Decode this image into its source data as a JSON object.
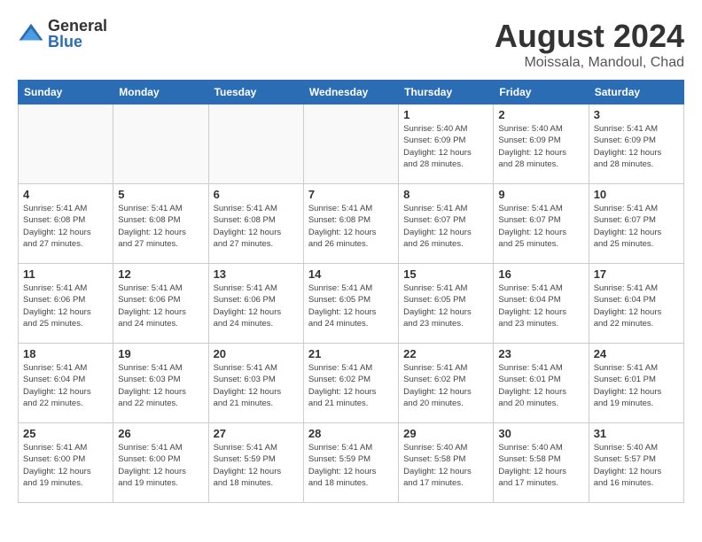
{
  "header": {
    "logo_general": "General",
    "logo_blue": "Blue",
    "month_year": "August 2024",
    "location": "Moissala, Mandoul, Chad"
  },
  "weekdays": [
    "Sunday",
    "Monday",
    "Tuesday",
    "Wednesday",
    "Thursday",
    "Friday",
    "Saturday"
  ],
  "weeks": [
    [
      {
        "day": "",
        "detail": ""
      },
      {
        "day": "",
        "detail": ""
      },
      {
        "day": "",
        "detail": ""
      },
      {
        "day": "",
        "detail": ""
      },
      {
        "day": "1",
        "detail": "Sunrise: 5:40 AM\nSunset: 6:09 PM\nDaylight: 12 hours\nand 28 minutes."
      },
      {
        "day": "2",
        "detail": "Sunrise: 5:40 AM\nSunset: 6:09 PM\nDaylight: 12 hours\nand 28 minutes."
      },
      {
        "day": "3",
        "detail": "Sunrise: 5:41 AM\nSunset: 6:09 PM\nDaylight: 12 hours\nand 28 minutes."
      }
    ],
    [
      {
        "day": "4",
        "detail": "Sunrise: 5:41 AM\nSunset: 6:08 PM\nDaylight: 12 hours\nand 27 minutes."
      },
      {
        "day": "5",
        "detail": "Sunrise: 5:41 AM\nSunset: 6:08 PM\nDaylight: 12 hours\nand 27 minutes."
      },
      {
        "day": "6",
        "detail": "Sunrise: 5:41 AM\nSunset: 6:08 PM\nDaylight: 12 hours\nand 27 minutes."
      },
      {
        "day": "7",
        "detail": "Sunrise: 5:41 AM\nSunset: 6:08 PM\nDaylight: 12 hours\nand 26 minutes."
      },
      {
        "day": "8",
        "detail": "Sunrise: 5:41 AM\nSunset: 6:07 PM\nDaylight: 12 hours\nand 26 minutes."
      },
      {
        "day": "9",
        "detail": "Sunrise: 5:41 AM\nSunset: 6:07 PM\nDaylight: 12 hours\nand 25 minutes."
      },
      {
        "day": "10",
        "detail": "Sunrise: 5:41 AM\nSunset: 6:07 PM\nDaylight: 12 hours\nand 25 minutes."
      }
    ],
    [
      {
        "day": "11",
        "detail": "Sunrise: 5:41 AM\nSunset: 6:06 PM\nDaylight: 12 hours\nand 25 minutes."
      },
      {
        "day": "12",
        "detail": "Sunrise: 5:41 AM\nSunset: 6:06 PM\nDaylight: 12 hours\nand 24 minutes."
      },
      {
        "day": "13",
        "detail": "Sunrise: 5:41 AM\nSunset: 6:06 PM\nDaylight: 12 hours\nand 24 minutes."
      },
      {
        "day": "14",
        "detail": "Sunrise: 5:41 AM\nSunset: 6:05 PM\nDaylight: 12 hours\nand 24 minutes."
      },
      {
        "day": "15",
        "detail": "Sunrise: 5:41 AM\nSunset: 6:05 PM\nDaylight: 12 hours\nand 23 minutes."
      },
      {
        "day": "16",
        "detail": "Sunrise: 5:41 AM\nSunset: 6:04 PM\nDaylight: 12 hours\nand 23 minutes."
      },
      {
        "day": "17",
        "detail": "Sunrise: 5:41 AM\nSunset: 6:04 PM\nDaylight: 12 hours\nand 22 minutes."
      }
    ],
    [
      {
        "day": "18",
        "detail": "Sunrise: 5:41 AM\nSunset: 6:04 PM\nDaylight: 12 hours\nand 22 minutes."
      },
      {
        "day": "19",
        "detail": "Sunrise: 5:41 AM\nSunset: 6:03 PM\nDaylight: 12 hours\nand 22 minutes."
      },
      {
        "day": "20",
        "detail": "Sunrise: 5:41 AM\nSunset: 6:03 PM\nDaylight: 12 hours\nand 21 minutes."
      },
      {
        "day": "21",
        "detail": "Sunrise: 5:41 AM\nSunset: 6:02 PM\nDaylight: 12 hours\nand 21 minutes."
      },
      {
        "day": "22",
        "detail": "Sunrise: 5:41 AM\nSunset: 6:02 PM\nDaylight: 12 hours\nand 20 minutes."
      },
      {
        "day": "23",
        "detail": "Sunrise: 5:41 AM\nSunset: 6:01 PM\nDaylight: 12 hours\nand 20 minutes."
      },
      {
        "day": "24",
        "detail": "Sunrise: 5:41 AM\nSunset: 6:01 PM\nDaylight: 12 hours\nand 19 minutes."
      }
    ],
    [
      {
        "day": "25",
        "detail": "Sunrise: 5:41 AM\nSunset: 6:00 PM\nDaylight: 12 hours\nand 19 minutes."
      },
      {
        "day": "26",
        "detail": "Sunrise: 5:41 AM\nSunset: 6:00 PM\nDaylight: 12 hours\nand 19 minutes."
      },
      {
        "day": "27",
        "detail": "Sunrise: 5:41 AM\nSunset: 5:59 PM\nDaylight: 12 hours\nand 18 minutes."
      },
      {
        "day": "28",
        "detail": "Sunrise: 5:41 AM\nSunset: 5:59 PM\nDaylight: 12 hours\nand 18 minutes."
      },
      {
        "day": "29",
        "detail": "Sunrise: 5:40 AM\nSunset: 5:58 PM\nDaylight: 12 hours\nand 17 minutes."
      },
      {
        "day": "30",
        "detail": "Sunrise: 5:40 AM\nSunset: 5:58 PM\nDaylight: 12 hours\nand 17 minutes."
      },
      {
        "day": "31",
        "detail": "Sunrise: 5:40 AM\nSunset: 5:57 PM\nDaylight: 12 hours\nand 16 minutes."
      }
    ]
  ]
}
